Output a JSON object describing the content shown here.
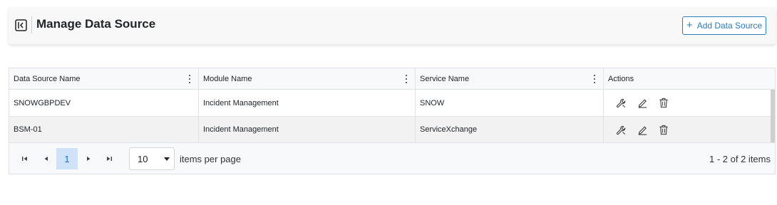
{
  "header": {
    "title": "Manage Data Source",
    "add_button_label": "Add Data Source"
  },
  "grid": {
    "columns": [
      {
        "label": "Data Source Name"
      },
      {
        "label": "Module Name"
      },
      {
        "label": "Service Name"
      },
      {
        "label": "Actions"
      }
    ],
    "rows": [
      {
        "data_source": "SNOWGBPDEV",
        "module": "Incident Management",
        "service": "SNOW"
      },
      {
        "data_source": "BSM-01",
        "module": "Incident Management",
        "service": "ServiceXchange"
      }
    ],
    "action_icons": [
      "wrench-icon",
      "edit-icon",
      "trash-icon"
    ]
  },
  "pager": {
    "current_page": "1",
    "page_size": "10",
    "items_per_page_label": "items per page",
    "info": "1 - 2 of 2 items"
  },
  "colors": {
    "accent": "#2b7bb9",
    "active_page_bg": "#cfe2f8",
    "header_bg": "#f8f8f8"
  }
}
